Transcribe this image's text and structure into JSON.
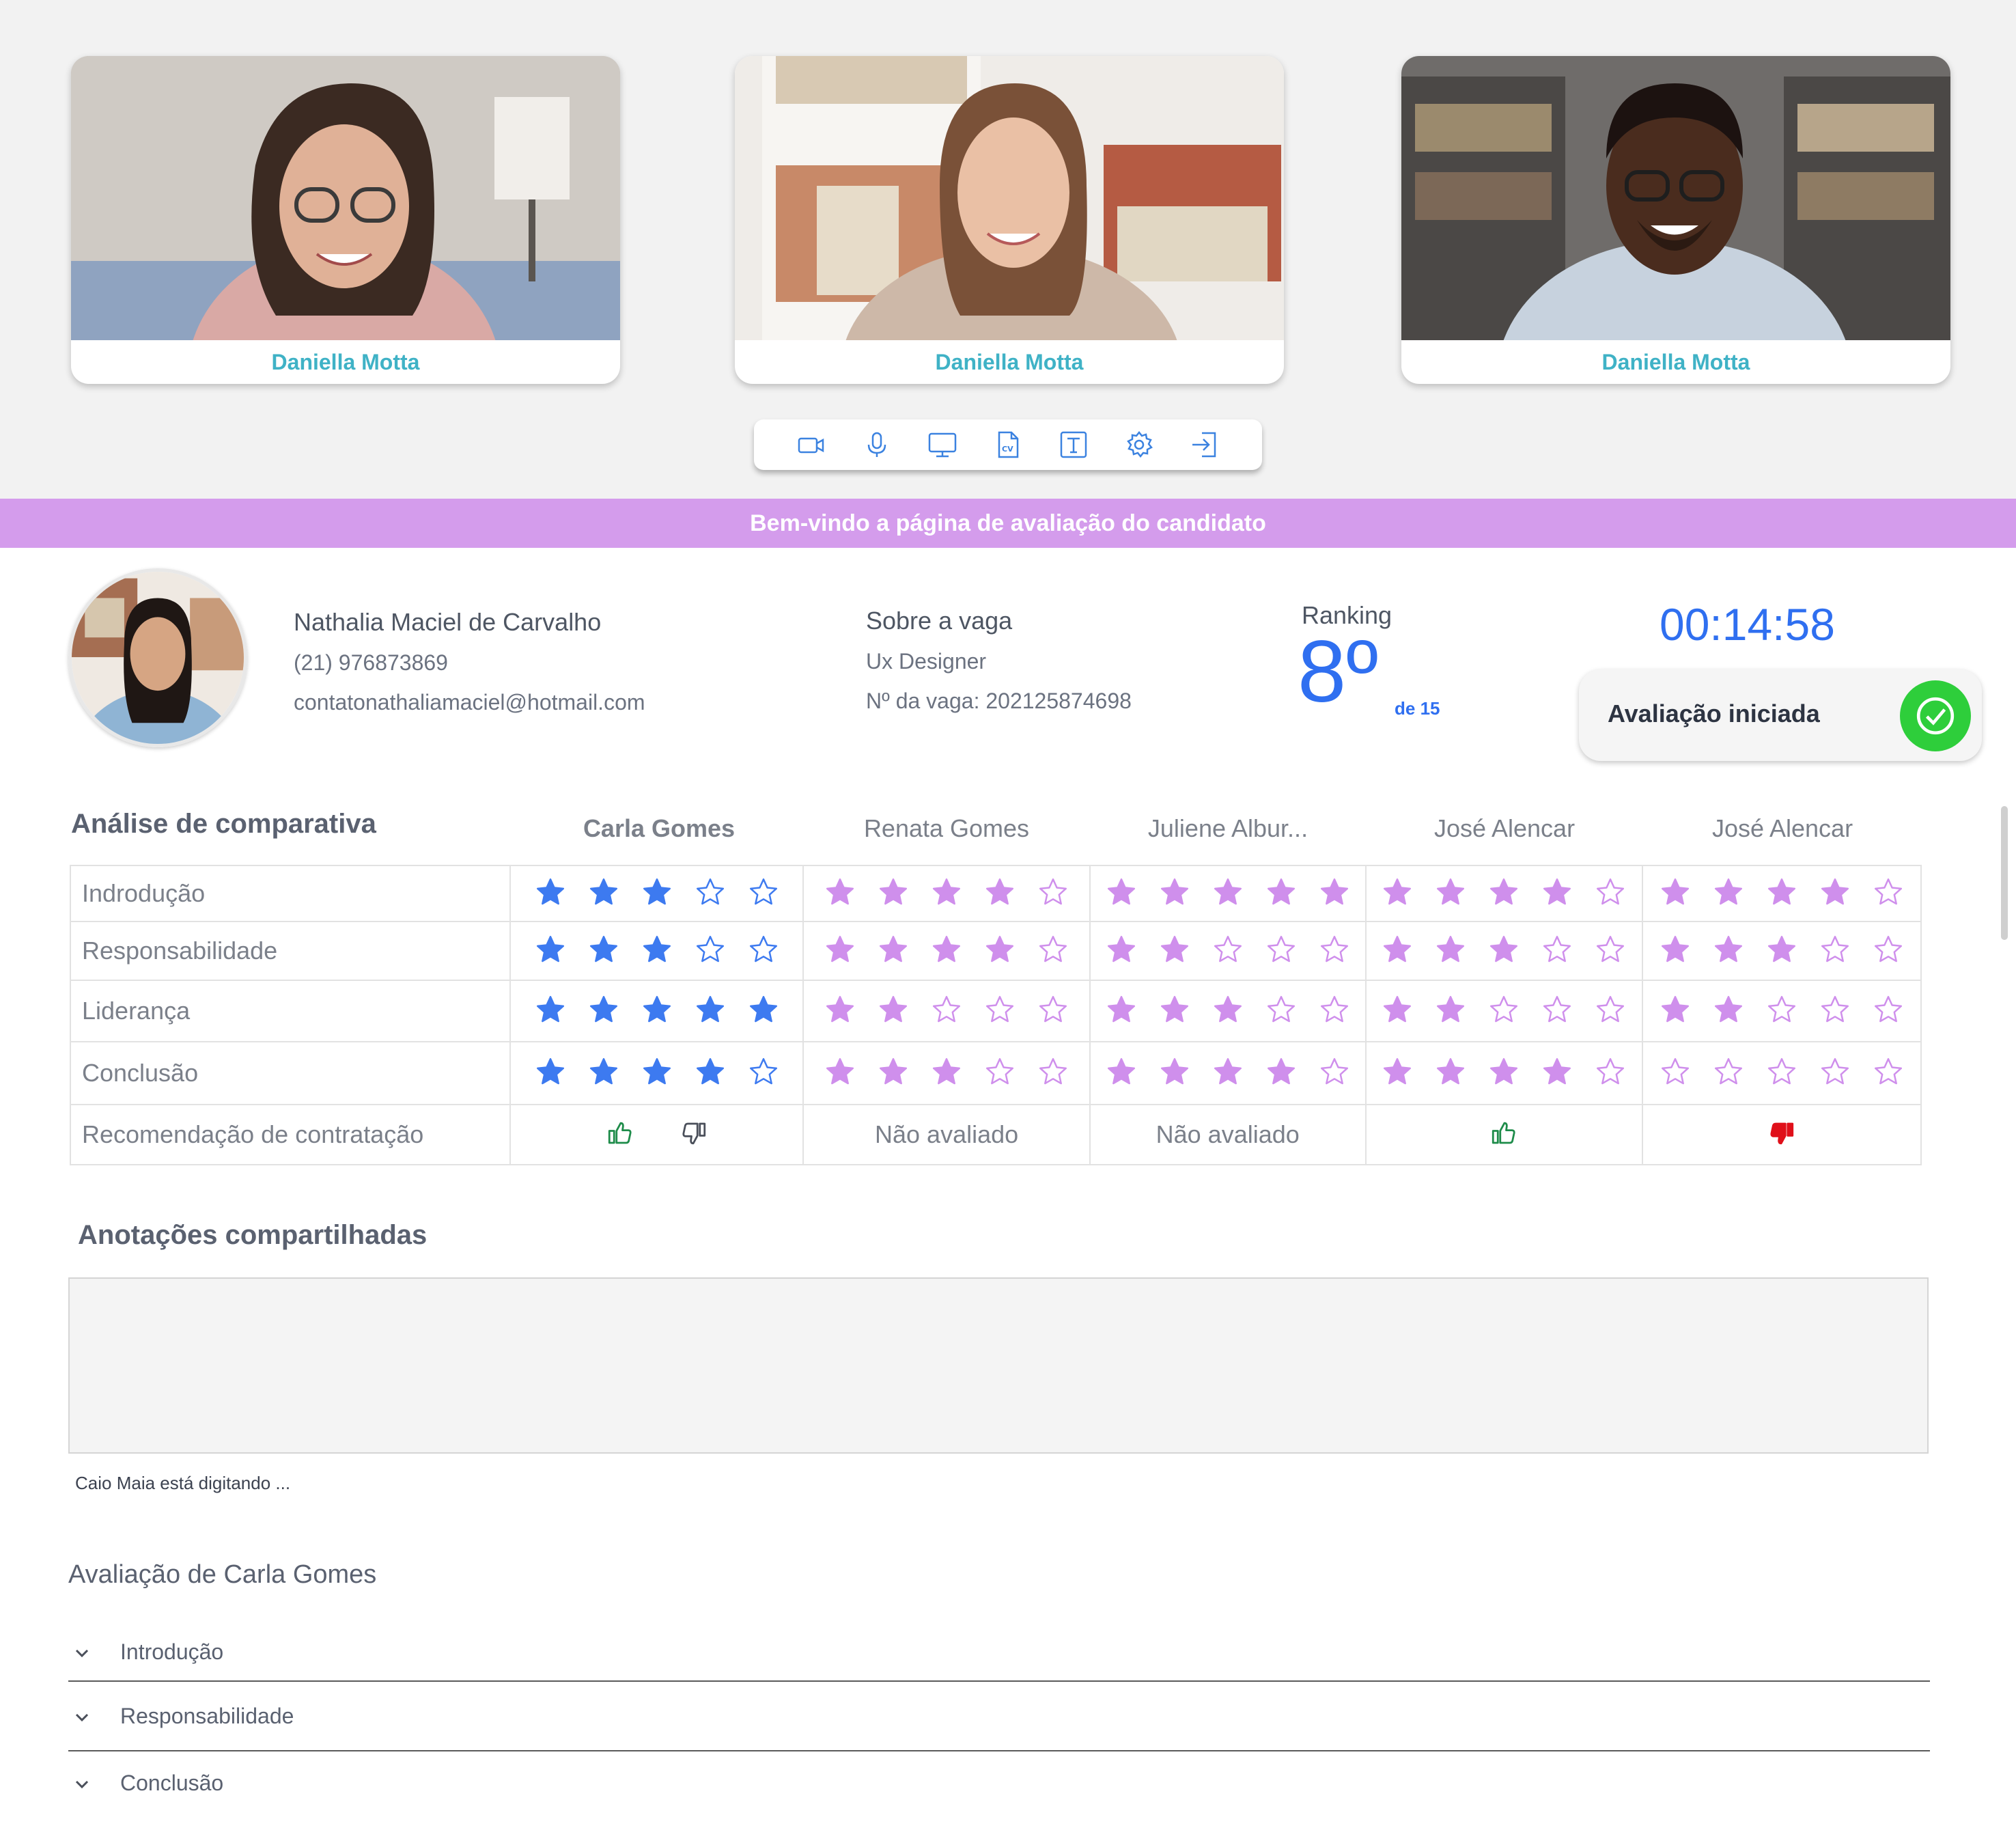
{
  "participants": [
    {
      "name": "Daniella Motta"
    },
    {
      "name": "Daniella Motta"
    },
    {
      "name": "Daniella Motta"
    }
  ],
  "toolbar_icons": [
    "camera-icon",
    "microphone-icon",
    "screen-share-icon",
    "cv-icon",
    "text-icon",
    "settings-icon",
    "exit-icon"
  ],
  "banner": "Bem-vindo a página de avaliação do candidato",
  "candidate": {
    "name": "Nathalia Maciel de Carvalho",
    "phone": "(21) 976873869",
    "email": "contatonathaliamaciel@hotmail.com"
  },
  "job": {
    "title": "Sobre a vaga",
    "role": "Ux Designer",
    "id": "Nº da vaga: 202125874698"
  },
  "ranking": {
    "label": "Ranking",
    "value": "8º",
    "of": "de 15"
  },
  "timer": "00:14:58",
  "status": "Avaliação iniciada",
  "comparison": {
    "title": "Análise de comparativa",
    "evaluators": [
      "Carla Gomes",
      "Renata Gomes",
      "Juliene Albur...",
      "José Alencar",
      "José Alencar"
    ],
    "criteria": [
      "Indrodução",
      "Responsabilidade",
      "Liderança",
      "Conclusão"
    ],
    "ratings": [
      [
        3,
        4,
        5,
        4,
        4
      ],
      [
        3,
        4,
        2,
        3,
        3
      ],
      [
        5,
        2,
        3,
        2,
        2
      ],
      [
        4,
        3,
        4,
        4,
        0
      ]
    ],
    "max_stars": 5,
    "recommendation_label": "Recomendação de contratação",
    "recommendations": [
      "both",
      "Não avaliado",
      "Não avaliado",
      "up",
      "down"
    ]
  },
  "colors": {
    "accent_blue": "#2f6ff0",
    "star_blue": "#3d7af0",
    "star_purple": "#cf8fec",
    "banner": "#d49cec",
    "name_teal": "#3fb2c6",
    "thumb_green": "#1e8c4a",
    "thumb_red": "#e0101a",
    "check_green": "#2ece3b"
  },
  "notes": {
    "title": "Anotações compartilhadas",
    "value": "",
    "typing": "Caio Maia está digitando ..."
  },
  "evaluation": {
    "title": "Avaliação de Carla  Gomes",
    "sections": [
      "Introdução",
      "Responsabilidade",
      "Conclusão"
    ]
  }
}
